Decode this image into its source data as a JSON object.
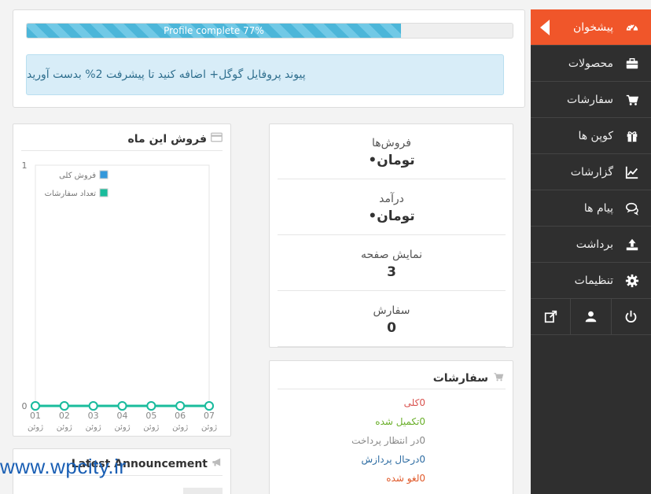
{
  "sidebar": {
    "items": [
      {
        "label": "پیشخوان",
        "icon": "dashboard-icon"
      },
      {
        "label": "محصولات",
        "icon": "briefcase-icon"
      },
      {
        "label": "سفارشات",
        "icon": "cart-icon"
      },
      {
        "label": "کوپن ها",
        "icon": "gift-icon"
      },
      {
        "label": "گزارشات",
        "icon": "chart-line-icon"
      },
      {
        "label": "پیام ها",
        "icon": "comments-icon"
      },
      {
        "label": "برداشت",
        "icon": "upload-icon"
      },
      {
        "label": "تنظیمات",
        "icon": "gear-icon"
      }
    ],
    "bottom_icons": [
      "external-link-icon",
      "user-icon",
      "power-icon"
    ],
    "colors": {
      "background": "#2f2f2f",
      "active": "#f0562a"
    }
  },
  "profile": {
    "progress_label": "Profile complete 77%",
    "progress_value": 77,
    "notice": "پیوند پروفایل گوگل+ اضافه کنید تا پیشرفت 2% بدست آورید"
  },
  "stats": [
    {
      "label": "فروش‌ها",
      "value": "•تومان"
    },
    {
      "label": "درآمد",
      "value": "•تومان"
    },
    {
      "label": "نمایش صفحه",
      "value": "3"
    },
    {
      "label": "سفارش",
      "value": "0"
    }
  ],
  "orders": {
    "title": "سفارشات",
    "rows": [
      {
        "text": "0کلی",
        "color": "#d9534f"
      },
      {
        "text": "0تکمیل شده",
        "color": "#6aaf2a"
      },
      {
        "text": "0در انتظار پرداخت",
        "color": "#888888"
      },
      {
        "text": "0درحال پردازش",
        "color": "#2d6ca2"
      },
      {
        "text": "0لغو شده",
        "color": "#e05a2b"
      }
    ]
  },
  "sales": {
    "title": "فروش این ماه"
  },
  "chart_data": {
    "type": "line",
    "categories": [
      "01",
      "02",
      "03",
      "04",
      "05",
      "06",
      "07"
    ],
    "category_sublabel": "ژوئن",
    "series": [
      {
        "name": "فروش کلی",
        "values": [
          0,
          0,
          0,
          0,
          0,
          0,
          0
        ],
        "color": "#3498db"
      },
      {
        "name": "تعداد سفارشات",
        "values": [
          0,
          0,
          0,
          0,
          0,
          0,
          0
        ],
        "color": "#1abc9c"
      }
    ],
    "ylim": [
      0,
      1
    ],
    "yticks": [
      "1",
      "0"
    ],
    "legend": "top-right",
    "grid": false
  },
  "announcement": {
    "title": "Latest Announcement",
    "icon": "megaphone-icon"
  },
  "watermark": "www.wpcity.ir"
}
